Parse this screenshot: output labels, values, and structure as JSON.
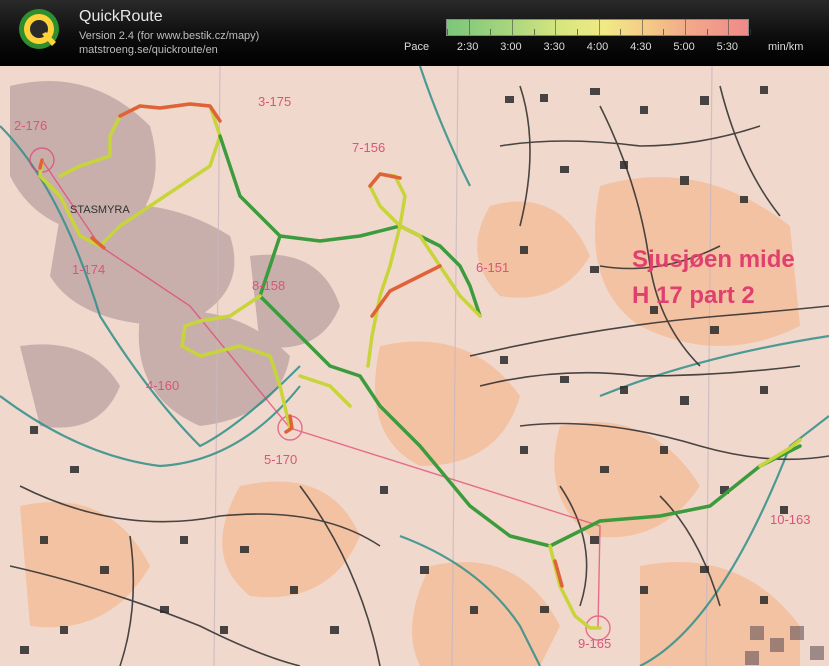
{
  "header": {
    "app_title": "QuickRoute",
    "version": "Version 2.4  (for www.bestik.cz/mapy)",
    "url": "matstroeng.se/quickroute/en",
    "logo_letter": "Q"
  },
  "pace_scale": {
    "label": "Pace",
    "unit": "min/km",
    "ticks": [
      "2:30",
      "3:00",
      "3:30",
      "4:00",
      "4:30",
      "5:00",
      "5:30"
    ],
    "min_pace": "2:15",
    "max_pace": "5:45",
    "colors": {
      "fast": "#7bc67b",
      "medium": "#f1ea86",
      "slow": "#ef8a8a"
    }
  },
  "map": {
    "controls": [
      "2-176",
      "3-175",
      "7-156",
      "6-151",
      "8-158",
      "1-174",
      "4-160",
      "5-170",
      "10-163",
      "9-165"
    ],
    "course_title_line1": "Sjusjøen mide",
    "course_title_line2": "H 17   part 2",
    "place_name": "STASMYRA",
    "route_colors": {
      "fast": "#3c9b3c",
      "medium": "#c7d43a",
      "slow": "#e0623a"
    }
  }
}
